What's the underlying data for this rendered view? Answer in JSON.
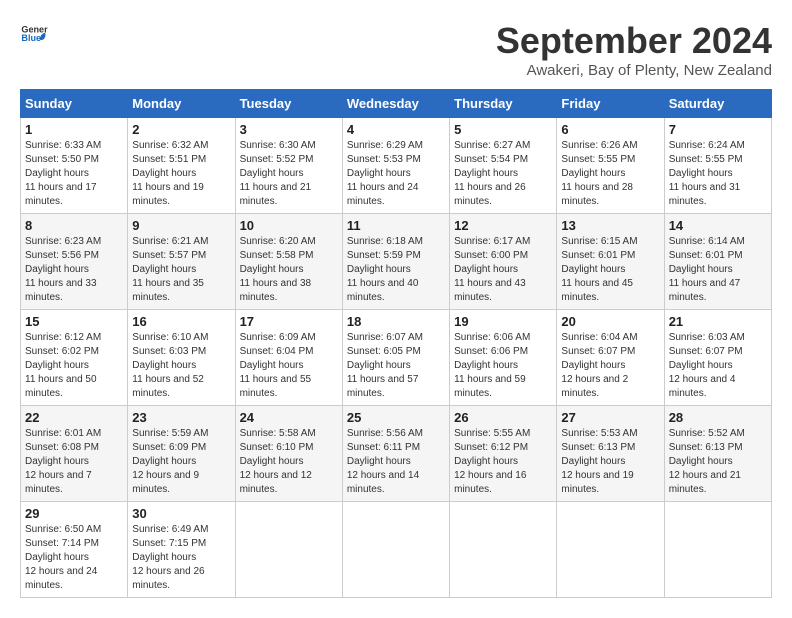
{
  "header": {
    "logo_general": "General",
    "logo_blue": "Blue",
    "month_year": "September 2024",
    "location": "Awakeri, Bay of Plenty, New Zealand"
  },
  "weekdays": [
    "Sunday",
    "Monday",
    "Tuesday",
    "Wednesday",
    "Thursday",
    "Friday",
    "Saturday"
  ],
  "weeks": [
    [
      {
        "day": "1",
        "sunrise": "6:33 AM",
        "sunset": "5:50 PM",
        "daylight": "11 hours and 17 minutes."
      },
      {
        "day": "2",
        "sunrise": "6:32 AM",
        "sunset": "5:51 PM",
        "daylight": "11 hours and 19 minutes."
      },
      {
        "day": "3",
        "sunrise": "6:30 AM",
        "sunset": "5:52 PM",
        "daylight": "11 hours and 21 minutes."
      },
      {
        "day": "4",
        "sunrise": "6:29 AM",
        "sunset": "5:53 PM",
        "daylight": "11 hours and 24 minutes."
      },
      {
        "day": "5",
        "sunrise": "6:27 AM",
        "sunset": "5:54 PM",
        "daylight": "11 hours and 26 minutes."
      },
      {
        "day": "6",
        "sunrise": "6:26 AM",
        "sunset": "5:55 PM",
        "daylight": "11 hours and 28 minutes."
      },
      {
        "day": "7",
        "sunrise": "6:24 AM",
        "sunset": "5:55 PM",
        "daylight": "11 hours and 31 minutes."
      }
    ],
    [
      {
        "day": "8",
        "sunrise": "6:23 AM",
        "sunset": "5:56 PM",
        "daylight": "11 hours and 33 minutes."
      },
      {
        "day": "9",
        "sunrise": "6:21 AM",
        "sunset": "5:57 PM",
        "daylight": "11 hours and 35 minutes."
      },
      {
        "day": "10",
        "sunrise": "6:20 AM",
        "sunset": "5:58 PM",
        "daylight": "11 hours and 38 minutes."
      },
      {
        "day": "11",
        "sunrise": "6:18 AM",
        "sunset": "5:59 PM",
        "daylight": "11 hours and 40 minutes."
      },
      {
        "day": "12",
        "sunrise": "6:17 AM",
        "sunset": "6:00 PM",
        "daylight": "11 hours and 43 minutes."
      },
      {
        "day": "13",
        "sunrise": "6:15 AM",
        "sunset": "6:01 PM",
        "daylight": "11 hours and 45 minutes."
      },
      {
        "day": "14",
        "sunrise": "6:14 AM",
        "sunset": "6:01 PM",
        "daylight": "11 hours and 47 minutes."
      }
    ],
    [
      {
        "day": "15",
        "sunrise": "6:12 AM",
        "sunset": "6:02 PM",
        "daylight": "11 hours and 50 minutes."
      },
      {
        "day": "16",
        "sunrise": "6:10 AM",
        "sunset": "6:03 PM",
        "daylight": "11 hours and 52 minutes."
      },
      {
        "day": "17",
        "sunrise": "6:09 AM",
        "sunset": "6:04 PM",
        "daylight": "11 hours and 55 minutes."
      },
      {
        "day": "18",
        "sunrise": "6:07 AM",
        "sunset": "6:05 PM",
        "daylight": "11 hours and 57 minutes."
      },
      {
        "day": "19",
        "sunrise": "6:06 AM",
        "sunset": "6:06 PM",
        "daylight": "11 hours and 59 minutes."
      },
      {
        "day": "20",
        "sunrise": "6:04 AM",
        "sunset": "6:07 PM",
        "daylight": "12 hours and 2 minutes."
      },
      {
        "day": "21",
        "sunrise": "6:03 AM",
        "sunset": "6:07 PM",
        "daylight": "12 hours and 4 minutes."
      }
    ],
    [
      {
        "day": "22",
        "sunrise": "6:01 AM",
        "sunset": "6:08 PM",
        "daylight": "12 hours and 7 minutes."
      },
      {
        "day": "23",
        "sunrise": "5:59 AM",
        "sunset": "6:09 PM",
        "daylight": "12 hours and 9 minutes."
      },
      {
        "day": "24",
        "sunrise": "5:58 AM",
        "sunset": "6:10 PM",
        "daylight": "12 hours and 12 minutes."
      },
      {
        "day": "25",
        "sunrise": "5:56 AM",
        "sunset": "6:11 PM",
        "daylight": "12 hours and 14 minutes."
      },
      {
        "day": "26",
        "sunrise": "5:55 AM",
        "sunset": "6:12 PM",
        "daylight": "12 hours and 16 minutes."
      },
      {
        "day": "27",
        "sunrise": "5:53 AM",
        "sunset": "6:13 PM",
        "daylight": "12 hours and 19 minutes."
      },
      {
        "day": "28",
        "sunrise": "5:52 AM",
        "sunset": "6:13 PM",
        "daylight": "12 hours and 21 minutes."
      }
    ],
    [
      {
        "day": "29",
        "sunrise": "6:50 AM",
        "sunset": "7:14 PM",
        "daylight": "12 hours and 24 minutes."
      },
      {
        "day": "30",
        "sunrise": "6:49 AM",
        "sunset": "7:15 PM",
        "daylight": "12 hours and 26 minutes."
      },
      null,
      null,
      null,
      null,
      null
    ]
  ]
}
